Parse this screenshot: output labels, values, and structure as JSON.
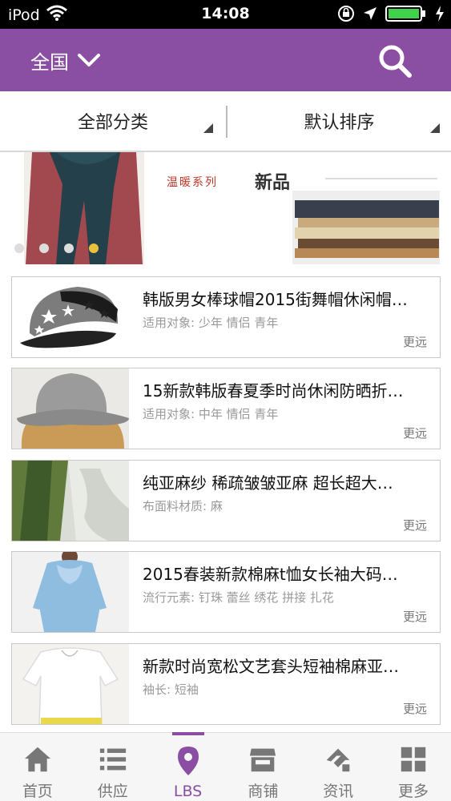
{
  "status_bar": {
    "carrier": "iPod",
    "time": "14:08"
  },
  "nav": {
    "region": "全国"
  },
  "filters": {
    "category": "全部分类",
    "sort": "默认排序"
  },
  "banner": {
    "text_series": "温暖系列",
    "text_new": "新品",
    "slide_count": 4,
    "active_slide": 4
  },
  "products": [
    {
      "title": "韩版男女棒球帽2015街舞帽休闲帽…",
      "attr": "适用对象: 少年 情侣 青年",
      "distance": "更远",
      "thumb": "cap"
    },
    {
      "title": "15新款韩版春夏季时尚休闲防晒折…",
      "attr": "适用对象: 中年 情侣 青年",
      "distance": "更远",
      "thumb": "bucket-hat"
    },
    {
      "title": "纯亚麻纱 稀疏皱皱亚麻 超长超大…",
      "attr": "布面料材质: 麻",
      "distance": "更远",
      "thumb": "scarf"
    },
    {
      "title": "2015春装新款棉麻t恤女长袖大码…",
      "attr": "流行元素: 钉珠 蕾丝 绣花 拼接 扎花",
      "distance": "更远",
      "thumb": "blue-shirt"
    },
    {
      "title": "新款时尚宽松文艺套头短袖棉麻亚…",
      "attr": "袖长: 短袖",
      "distance": "更远",
      "thumb": "white-shirt"
    }
  ],
  "tabs": [
    {
      "label": "首页",
      "icon": "home-icon"
    },
    {
      "label": "供应",
      "icon": "list-icon"
    },
    {
      "label": "LBS",
      "icon": "location-pin-icon"
    },
    {
      "label": "商铺",
      "icon": "shop-icon"
    },
    {
      "label": "资讯",
      "icon": "news-icon"
    },
    {
      "label": "更多",
      "icon": "grid-icon"
    }
  ],
  "active_tab": "LBS",
  "colors": {
    "primary": "#8a4ea3",
    "dot_active": "#e8c23c"
  }
}
